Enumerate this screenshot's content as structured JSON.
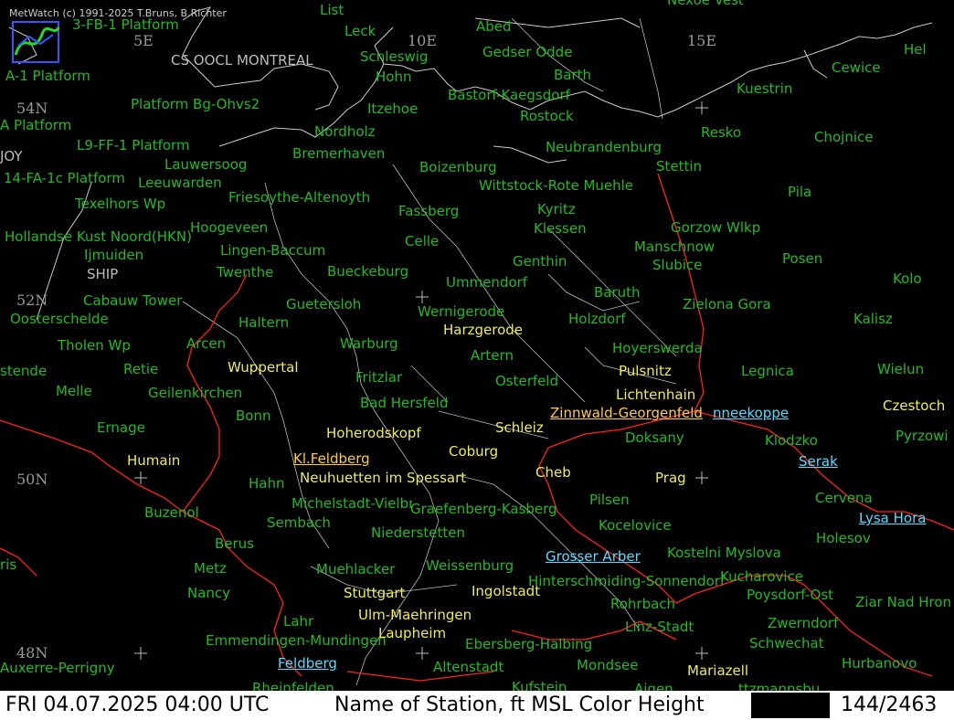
{
  "app": {
    "copyright": "MetWatch  (c) 1991-2025 T.Bruns, B.Richter"
  },
  "status": {
    "datetime": "FRI 04.07.2025 04:00 UTC",
    "description": "Name of Station,  ft MSL Color Height",
    "count": "144/2463"
  },
  "grid": {
    "lon": [
      "5E",
      "10E",
      "15E"
    ],
    "lat": [
      "54N",
      "52N",
      "50N",
      "48N"
    ]
  },
  "ships": [
    "CS OOCL MONTREAL",
    "SHIP",
    "JOY"
  ],
  "stations_green": [
    "List",
    "3-FB-1 Platform",
    "Abed",
    "Nexoe Vest",
    "Leck",
    "Hel",
    "A-1 Platform",
    "Schleswig",
    "Gedser Odde",
    "Cewice",
    "Hohn",
    "Barth",
    "Platform Bg-Ohvs2",
    "Bastorf-Kaegsdorf",
    "Kuestrin",
    "Itzehoe",
    "Rostock",
    "A Platform",
    "Nordholz",
    "Resko",
    "Chojnice",
    "L9-FF-1 Platform",
    "Neubrandenburg",
    "Bremerhaven",
    "Lauwersoog",
    "Boizenburg",
    "Stettin",
    "14-FA-1c Platform",
    "Leeuwarden",
    "Wittstock-Rote Muehle",
    "Friesoythe-Altenoyth",
    "Pila",
    "Texelhors Wp",
    "Fassberg",
    "Kyritz",
    "Hoogeveen",
    "Klessen",
    "Gorzow Wlkp",
    "Hollandse Kust Noord(HKN)",
    "Celle",
    "Manschnow",
    "Lingen-Baccum",
    "Ijmuiden",
    "Genthin",
    "Slubice",
    "Posen",
    "Twenthe",
    "Bueckeburg",
    "Kolo",
    "Ummendorf",
    "Cabauw Tower",
    "Baruth",
    "Guetersloh",
    "Zielona Gora",
    "Oosterschelde",
    "Wernigerode",
    "Holzdorf",
    "Kalisz",
    "Haltern",
    "Arcen",
    "Warburg",
    "Hoyerswerda",
    "Tholen Wp",
    "Artern",
    "stende",
    "Retie",
    "Legnica",
    "Wielun",
    "Fritzlar",
    "Osterfeld",
    "Melle",
    "Geilenkirchen",
    "Ernage",
    "Doksany",
    "Klodzko",
    "Bonn",
    "Pyrzowi",
    "Herodskopf"
  ],
  "stations_green_sw": [
    "Hahn",
    "Michelstadt-Vielbrunn",
    "Graefenberg-Kasberg",
    "Pilsen",
    "Buzenol",
    "Sembach",
    "Kocelovice",
    "Niederstetten",
    "Berus",
    "Kostelni Myslova",
    "Metz",
    "Muehlacker",
    "Weissenburg",
    "Kucharovice",
    "Hinterschmiding-Sonnendorf",
    "Nancy",
    "Poysdorf-Ost",
    "Rohrbach",
    "Lahr",
    "Zwerndorf",
    "Linz-Stadt",
    "Emmendingen-Mundingen",
    "Ebersberg-Halbing",
    "Schwechat",
    "Auxerre-Perrigny",
    "Altenstadt",
    "Hurbanovo",
    "Mondsee",
    "Rheinfelden",
    "Kufstein",
    "Ziar Nad Hron",
    "Holesov",
    "Cervena",
    "ris",
    "Bad Hersfeld"
  ],
  "stations_yellow": [
    "Harzgerode",
    "Pulsnitz",
    "Wuppertal",
    "Lichtenhain",
    "Hoherodskopf",
    "Schleiz",
    "Coburg",
    "Humain",
    "Neuhuetten im Spessart",
    "Cheb",
    "Prag",
    "Stuttgart",
    "Ingolstadt",
    "Ulm-Maehringen",
    "Laupheim",
    "Czestoch",
    "Mariazell"
  ],
  "stations_highlight": {
    "zinnwald": "Zinnwald-Georgenfeld",
    "kl_feldberg": "Kl.Feldberg",
    "schneekoppe": "nneekoppe",
    "serak": "Serak",
    "lysa_hora": "Lysa Hora",
    "grosser_arber": "Grosser Arber",
    "feldberg": "Feldberg",
    "ttmannsburg": "ttzmannsbu",
    "aigen": "Aigen"
  },
  "colors": {
    "green": "#22bb22",
    "yellow": "#eeee55",
    "cyan": "#55ddff",
    "orange": "#ffcc44",
    "border": "#ff2020",
    "coast": "#cccccc"
  }
}
